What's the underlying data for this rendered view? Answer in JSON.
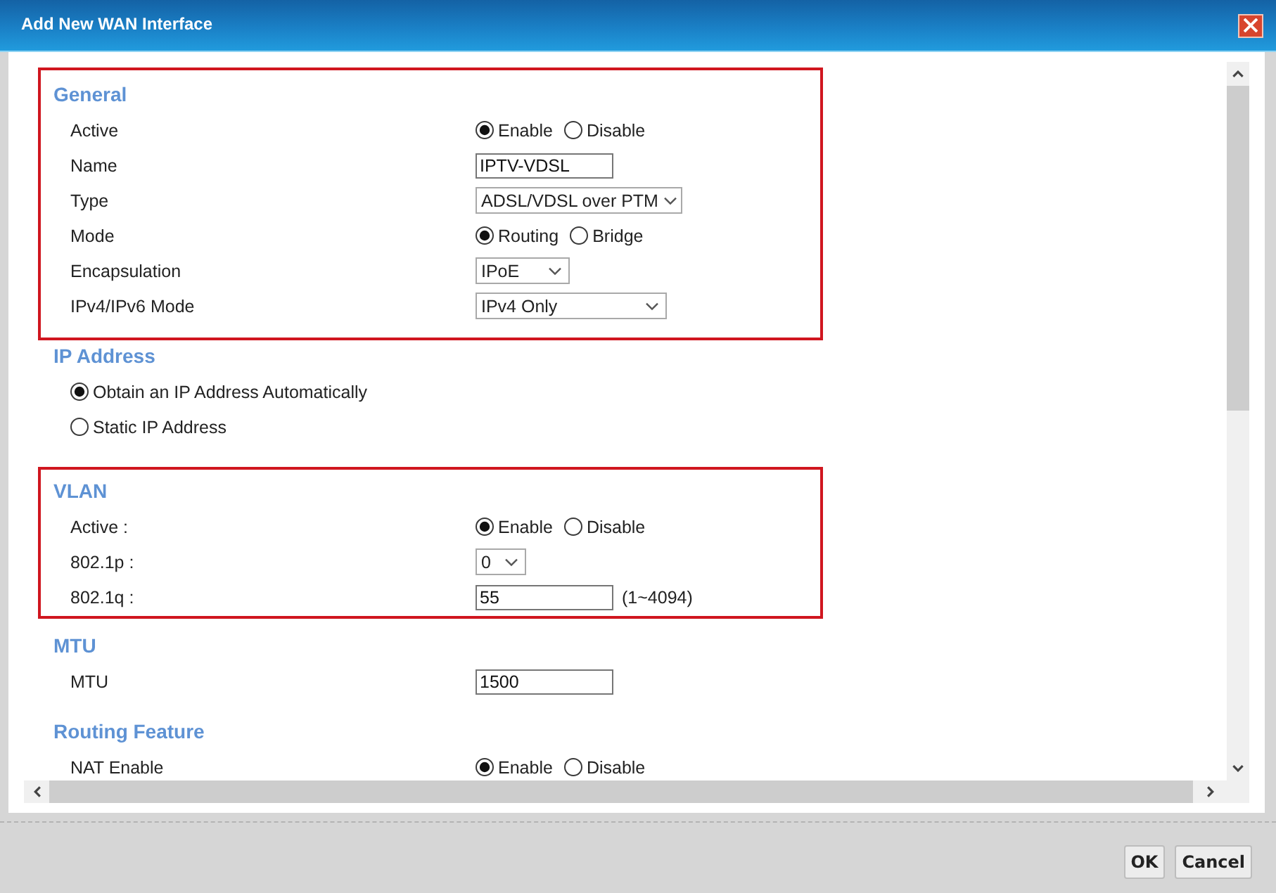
{
  "window": {
    "title": "Add New WAN Interface"
  },
  "sections": [
    {
      "title": "General",
      "highlighted": true,
      "fields": [
        {
          "kind": "radio",
          "label": "Active",
          "options": [
            {
              "label": "Enable",
              "selected": true
            },
            {
              "label": "Disable",
              "selected": false
            }
          ]
        },
        {
          "kind": "text",
          "label": "Name",
          "value": "IPTV-VDSL"
        },
        {
          "kind": "select",
          "label": "Type",
          "value": "ADSL/VDSL over PTM"
        },
        {
          "kind": "radio",
          "label": "Mode",
          "options": [
            {
              "label": "Routing",
              "selected": true
            },
            {
              "label": "Bridge",
              "selected": false
            }
          ]
        },
        {
          "kind": "select",
          "label": "Encapsulation",
          "value": "IPoE"
        },
        {
          "kind": "select",
          "label": "IPv4/IPv6 Mode",
          "value": "IPv4 Only"
        }
      ]
    },
    {
      "title": "IP Address",
      "highlighted": false,
      "fields": [
        {
          "kind": "radio_list",
          "options": [
            {
              "label": "Obtain an IP Address Automatically",
              "selected": true
            },
            {
              "label": "Static IP Address",
              "selected": false
            }
          ]
        }
      ]
    },
    {
      "title": "VLAN",
      "highlighted": true,
      "fields": [
        {
          "kind": "radio",
          "label": "Active :",
          "options": [
            {
              "label": "Enable",
              "selected": true
            },
            {
              "label": "Disable",
              "selected": false
            }
          ]
        },
        {
          "kind": "select",
          "label": "802.1p :",
          "value": "0"
        },
        {
          "kind": "text",
          "label": "802.1q :",
          "value": "55",
          "hint": "(1~4094)"
        }
      ]
    },
    {
      "title": "MTU",
      "highlighted": false,
      "fields": [
        {
          "kind": "text",
          "label": "MTU",
          "value": "1500"
        }
      ]
    },
    {
      "title": "Routing Feature",
      "highlighted": false,
      "fields": [
        {
          "kind": "radio",
          "label": "NAT Enable",
          "options": [
            {
              "label": "Enable",
              "selected": true
            },
            {
              "label": "Disable",
              "selected": false
            }
          ]
        }
      ]
    }
  ],
  "buttons": [
    "OK",
    "Cancel"
  ]
}
